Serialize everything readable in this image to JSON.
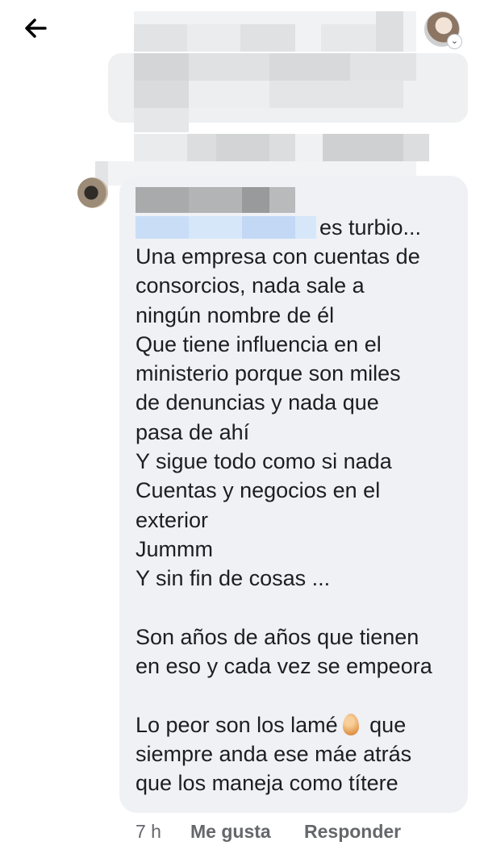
{
  "header": {
    "back_icon": "arrow-left-icon"
  },
  "comment": {
    "first_line_visible": "es turbio...",
    "lines_before_emoji": "Una empresa con cuentas de\nconsorcios, nada sale a\nningún nombre de él\nQue tiene influencia en el\nministerio porque son miles\nde denuncias y nada que\npasa de ahí\nY sigue todo como si nada\nCuentas y negocios en el\nexterior\nJummm\nY sin fin de cosas ...\n\nSon años de años que tienen\nen eso y cada vez se empeora\n\nLo peor son los lamé",
    "emoji_name": "egg-emoji",
    "lines_after_emoji": " que\nsiempre anda ese máe atrás\nque los maneja como títere"
  },
  "actions": {
    "time": "7 h",
    "like_label": "Me gusta",
    "reply_label": "Responder"
  },
  "colors": {
    "bubble_bg": "#eff1f5",
    "meta_text": "#65676b",
    "text": "#1c1e21"
  }
}
